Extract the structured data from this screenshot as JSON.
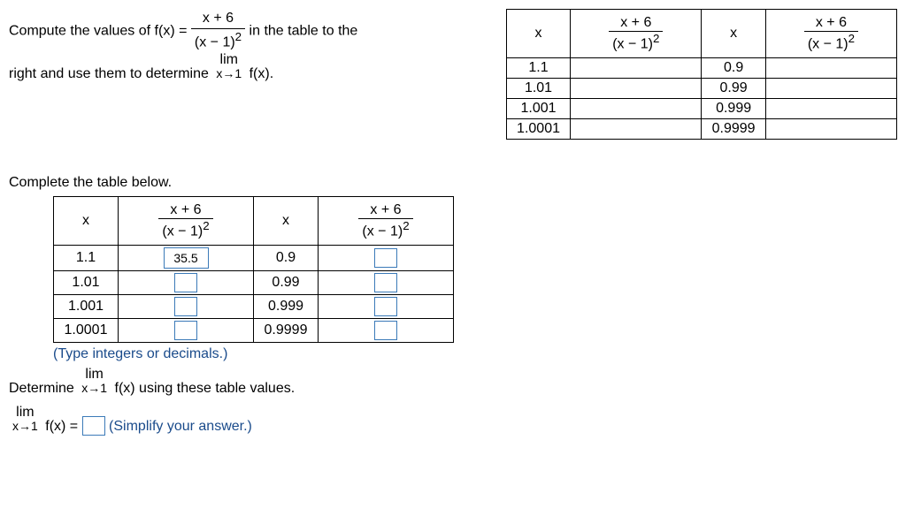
{
  "problem": {
    "intro1": "Compute the values of f(x) = ",
    "frac_num": "x + 6",
    "frac_den": "(x − 1)",
    "frac_exp": "2",
    "intro2": " in the table to the",
    "line2_a": "right and use them to determine ",
    "lim_label": "lim",
    "lim_sub": "x→1",
    "fx": " f(x)."
  },
  "top_table": {
    "headers": {
      "x": "x"
    },
    "rows_left": [
      "1.1",
      "1.01",
      "1.001",
      "1.0001"
    ],
    "rows_right": [
      "0.9",
      "0.99",
      "0.999",
      "0.9999"
    ]
  },
  "section2": {
    "title": "Complete the table below.",
    "note": "(Type integers or decimals.)",
    "determine": "Determine ",
    "using": " f(x) using these table values.",
    "lim_eq": " f(x) = ",
    "simplify": " (Simplify your answer.)"
  },
  "answer_table": {
    "rows_left": [
      {
        "x": "1.1",
        "val": "35.5"
      },
      {
        "x": "1.01",
        "val": ""
      },
      {
        "x": "1.001",
        "val": ""
      },
      {
        "x": "1.0001",
        "val": ""
      }
    ],
    "rows_right": [
      {
        "x": "0.9",
        "val": ""
      },
      {
        "x": "0.99",
        "val": ""
      },
      {
        "x": "0.999",
        "val": ""
      },
      {
        "x": "0.9999",
        "val": ""
      }
    ]
  }
}
